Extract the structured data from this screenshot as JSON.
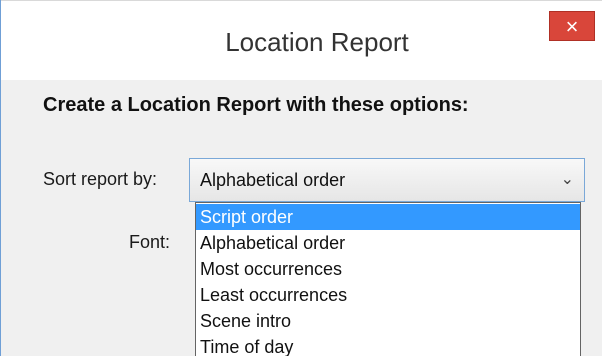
{
  "window": {
    "title": "Location Report",
    "close_label": "×"
  },
  "content": {
    "heading": "Create a Location Report with these options:",
    "sort_label": "Sort report by:",
    "font_label": "Font:"
  },
  "sort_select": {
    "value": "Alphabetical order",
    "chevron": "⌄",
    "options": [
      "Script order",
      "Alphabetical order",
      "Most occurrences",
      "Least occurrences",
      "Scene intro",
      "Time of day"
    ],
    "highlighted_index": 0
  },
  "colors": {
    "highlight": "#3399ff",
    "close_button": "#d9463a"
  }
}
